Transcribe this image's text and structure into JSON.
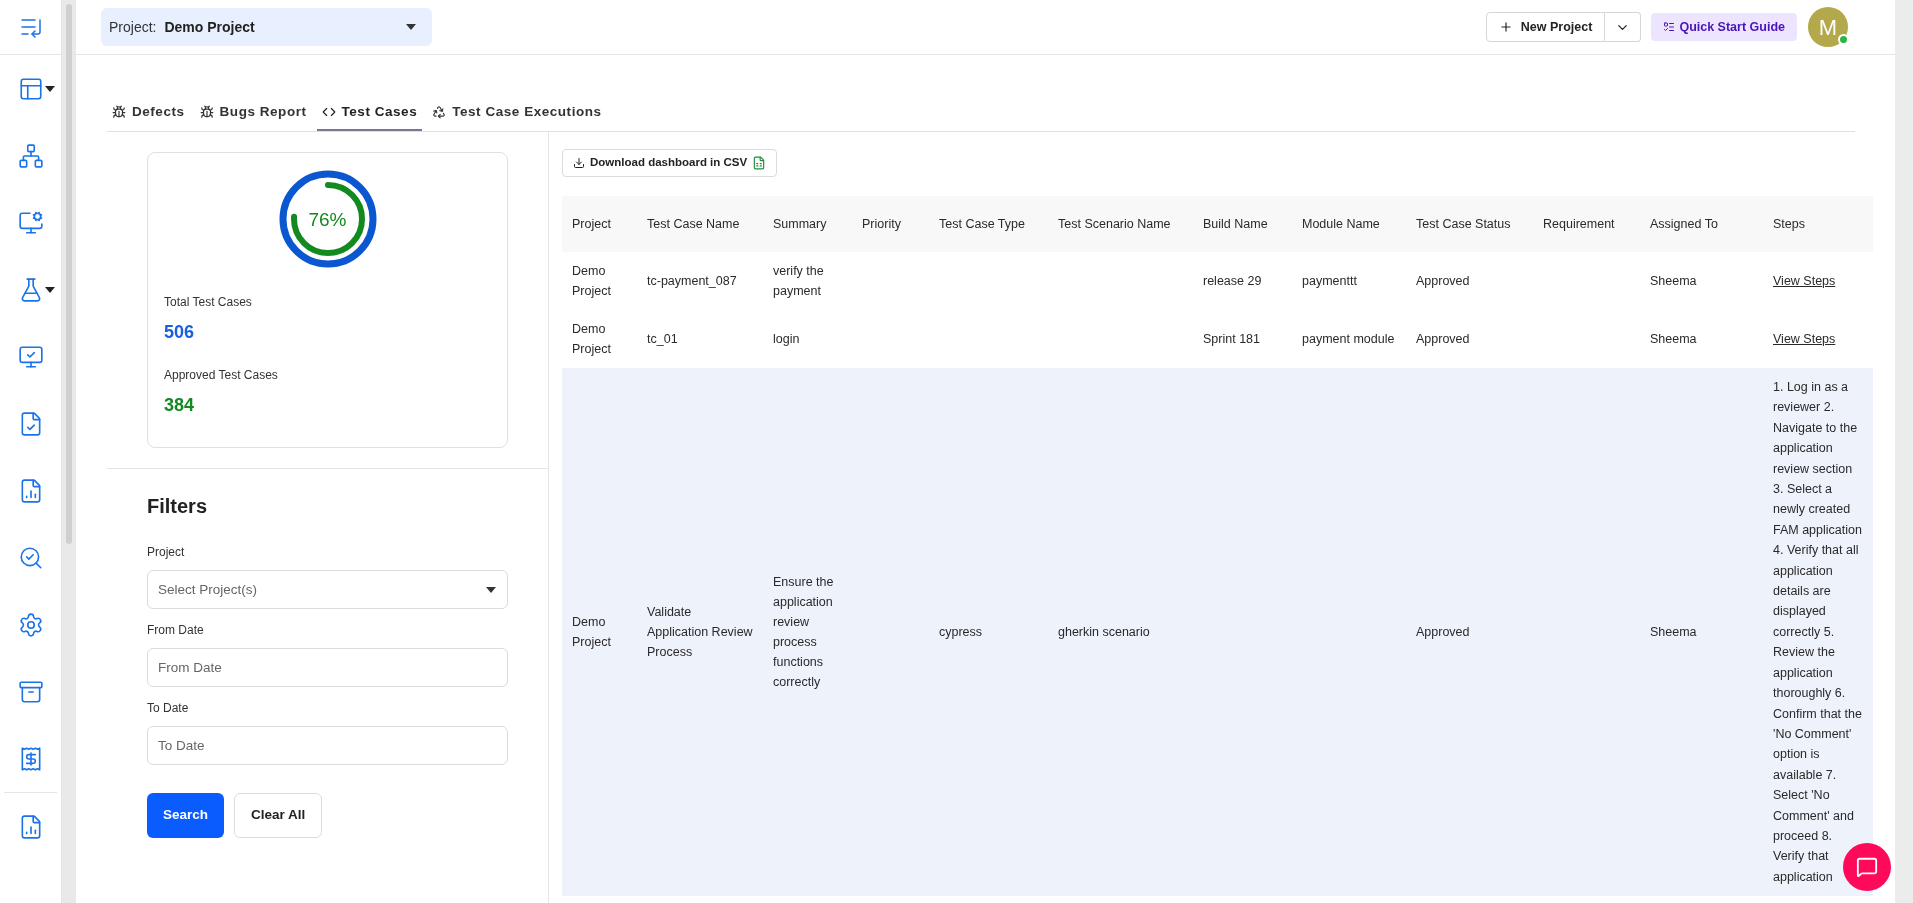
{
  "header": {
    "project_selector": {
      "label": "Project:",
      "value": "Demo Project"
    },
    "new_project": "New Project",
    "quick_start": "Quick Start Guide",
    "avatar": {
      "initial": "M",
      "online": true
    }
  },
  "tabs": [
    {
      "label": "Defects",
      "kind": "bug",
      "selected": false
    },
    {
      "label": "Bugs Report",
      "kind": "bug",
      "selected": false
    },
    {
      "label": "Test Cases",
      "kind": "code",
      "selected": true
    },
    {
      "label": "Test Case Executions",
      "kind": "recycle",
      "selected": false
    }
  ],
  "summary": {
    "level": 0.76,
    "percent": "76%",
    "stats": [
      {
        "label": "Total Test Cases",
        "value": "506",
        "kind": "total"
      },
      {
        "label": "Approved Test Cases",
        "value": "384",
        "kind": "approved"
      }
    ]
  },
  "filters": {
    "title": "Filters",
    "fields": [
      {
        "label": "Project",
        "placeholder": "Select Project(s)",
        "kind": "select"
      },
      {
        "label": "From Date",
        "placeholder": "From Date",
        "kind": "date"
      },
      {
        "label": "To Date",
        "placeholder": "To Date",
        "kind": "date"
      }
    ],
    "buttons": [
      {
        "label": "Search",
        "kind": "primary"
      },
      {
        "label": "Clear All",
        "kind": "secondary"
      }
    ]
  },
  "download_button": "Download dashboard in CSV",
  "table": {
    "columns": [
      "Project",
      "Test Case Name",
      "Summary",
      "Priority",
      "Test Case Type",
      "Test Scenario Name",
      "Build Name",
      "Module Name",
      "Test Case Status",
      "Requirement",
      "Assigned To",
      "Steps"
    ],
    "rows": [
      {
        "selected": false,
        "cells": [
          "Demo Project",
          "tc-payment_087",
          "verify the payment",
          null,
          null,
          null,
          "release 29",
          "paymenttt",
          "Approved",
          null,
          "Sheema"
        ],
        "steps": {
          "kind": "link",
          "text": "View Steps"
        }
      },
      {
        "selected": false,
        "cells": [
          "Demo Project",
          "tc_01",
          "login",
          null,
          null,
          null,
          "Sprint 181",
          "payment module",
          "Approved",
          null,
          "Sheema"
        ],
        "steps": {
          "kind": "link",
          "text": "View Steps"
        }
      },
      {
        "selected": true,
        "cells": [
          "Demo Project",
          "Validate Application Review Process",
          "Ensure the application review process functions correctly",
          null,
          "cypress",
          "gherkin scenario",
          null,
          null,
          "Approved",
          null,
          "Sheema"
        ],
        "steps": {
          "kind": "text",
          "text": "1. Log in as a reviewer 2. Navigate to the application review section 3. Select a newly created FAM application 4. Verify that all application details are displayed correctly 5. Review the application thoroughly 6. Confirm that the 'No Comment' option is available 7. Select 'No Comment' and proceed 8. Verify that application"
        }
      }
    ]
  }
}
